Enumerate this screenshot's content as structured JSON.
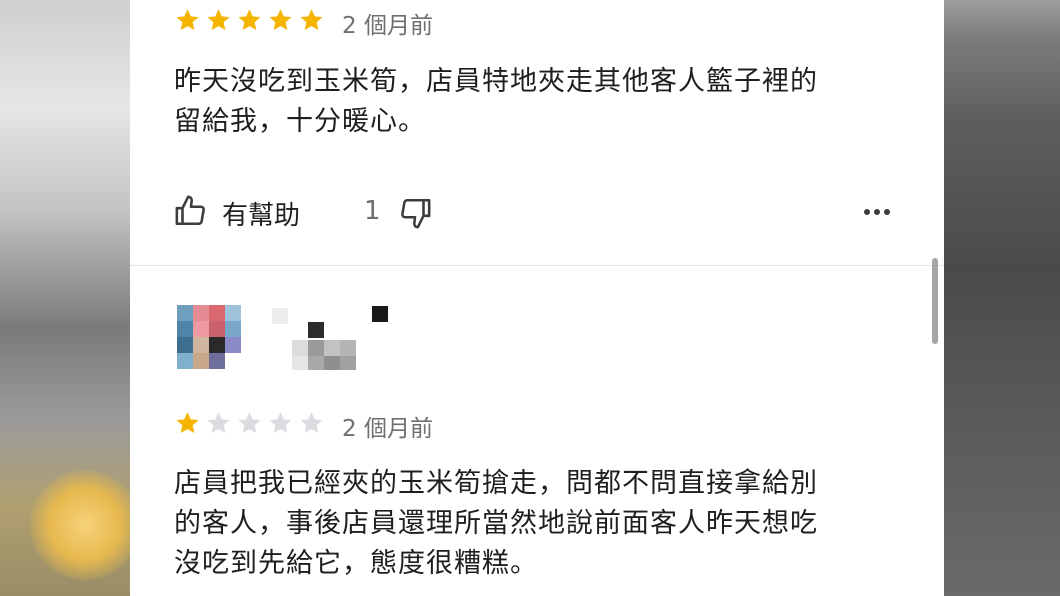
{
  "reviews": [
    {
      "rating": 5,
      "max_rating": 5,
      "date": "2 個月前",
      "lines": [
        "昨天沒吃到玉米筍，店員特地夾走其他客人籃子裡的",
        "留給我，十分暖心。"
      ],
      "helpful_label": "有幫助",
      "helpful_count": "1"
    },
    {
      "rating": 1,
      "max_rating": 5,
      "date": "2 個月前",
      "lines": [
        "店員把我已經夾的玉米筍搶走，問都不問直接拿給別",
        "的客人，事後店員還理所當然地說前面客人昨天想吃",
        "沒吃到先給它，態度很糟糕。"
      ]
    }
  ],
  "icons": {
    "helpful": "thumbs-up-icon",
    "not_helpful": "thumbs-down-icon",
    "more": "more-options-icon",
    "star": "star-icon"
  },
  "colors": {
    "star_filled": "#f4b400",
    "star_empty": "#dadce0",
    "text": "#1f1f1f",
    "meta_text": "#6f6f6f",
    "panel_bg": "#ffffff"
  }
}
